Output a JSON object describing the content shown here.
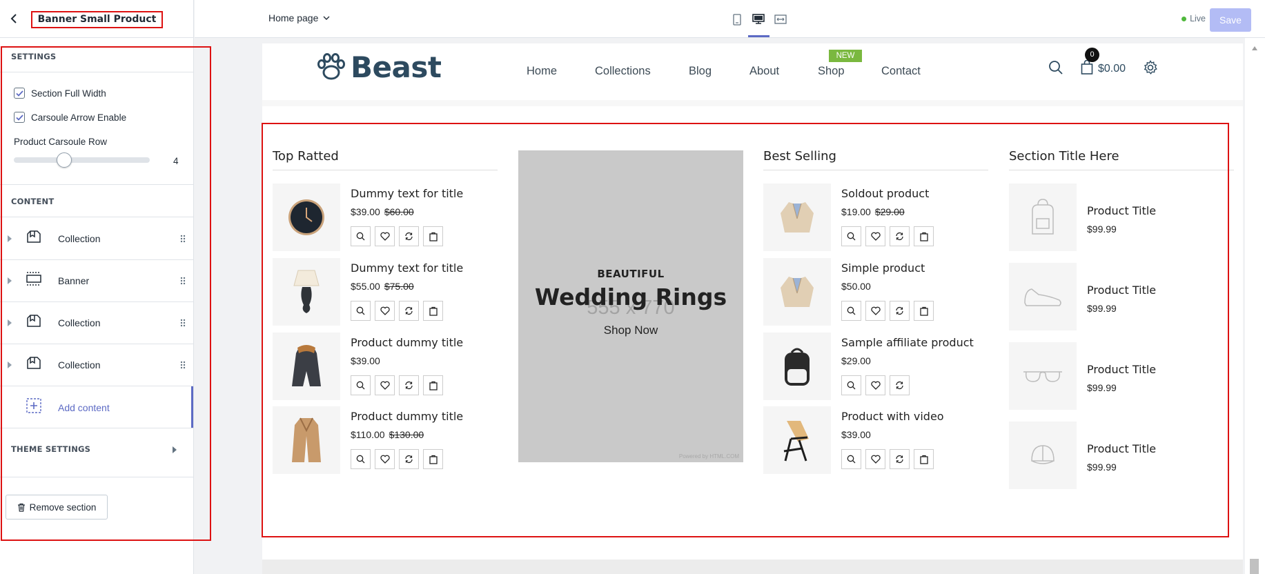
{
  "editor": {
    "panel_title": "Banner Small Product",
    "settings_heading": "SETTINGS",
    "full_width_label": "Section Full Width",
    "arrow_label": "Carsoule Arrow Enable",
    "row_label": "Product Carsoule Row",
    "row_value": "4",
    "row_slider_fraction": 0.35,
    "content_heading": "CONTENT",
    "blocks": [
      {
        "label": "Collection",
        "icon": "collection-icon"
      },
      {
        "label": "Banner",
        "icon": "banner-icon"
      },
      {
        "label": "Collection",
        "icon": "collection-icon"
      },
      {
        "label": "Collection",
        "icon": "collection-icon"
      }
    ],
    "add_content_label": "Add content",
    "theme_settings_heading": "THEME SETTINGS",
    "remove_label": "Remove section",
    "page_select": "Home page",
    "live_label": "Live",
    "save_label": "Save",
    "accent": "#5c6ac4"
  },
  "store": {
    "logo_text": "Beast",
    "nav": [
      "Home",
      "Collections",
      "Blog",
      "About",
      "Shop",
      "Contact"
    ],
    "new_badge": "NEW",
    "cart_count": "0",
    "cart_amount": "$0.00"
  },
  "columns": [
    {
      "title": "Top Ratted",
      "products": [
        {
          "title": "Dummy text for title",
          "price": "$39.00",
          "old_price": "$60.00",
          "image": "watch-icon",
          "actions": 4
        },
        {
          "title": "Dummy text for title",
          "price": "$55.00",
          "old_price": "$75.00",
          "image": "lamp-icon",
          "actions": 4
        },
        {
          "title": "Product dummy title",
          "price": "$39.00",
          "old_price": "",
          "image": "jacket-icon",
          "actions": 4
        },
        {
          "title": "Product dummy title",
          "price": "$110.00",
          "old_price": "$130.00",
          "image": "coat-icon",
          "actions": 4
        }
      ]
    },
    {
      "title": "Best Selling",
      "products": [
        {
          "title": "Soldout product",
          "price": "$19.00",
          "old_price": "$29.00",
          "image": "blazer-icon",
          "actions": 4
        },
        {
          "title": "Simple product",
          "price": "$50.00",
          "old_price": "",
          "image": "blazer-icon",
          "actions": 4
        },
        {
          "title": "Sample affiliate product",
          "price": "$29.00",
          "old_price": "",
          "image": "backpack-icon",
          "actions": 3
        },
        {
          "title": "Product with video",
          "price": "$39.00",
          "old_price": "",
          "image": "chair-icon",
          "actions": 4
        }
      ]
    },
    {
      "title": "Section Title Here",
      "products": [
        {
          "title": "Product Title",
          "price": "$99.99",
          "old_price": "",
          "image": "bag-placeholder-icon",
          "actions": 0
        },
        {
          "title": "Product Title",
          "price": "$99.99",
          "old_price": "",
          "image": "shoe-placeholder-icon",
          "actions": 0
        },
        {
          "title": "Product Title",
          "price": "$99.99",
          "old_price": "",
          "image": "glasses-placeholder-icon",
          "actions": 0
        },
        {
          "title": "Product Title",
          "price": "$99.99",
          "old_price": "",
          "image": "cap-placeholder-icon",
          "actions": 0
        }
      ]
    }
  ],
  "banner": {
    "subtitle": "BEAUTIFUL",
    "ghost_text": "555 x 770",
    "title": "Wedding Rings",
    "link": "Shop Now",
    "credit": "Powered by HTML.COM"
  }
}
